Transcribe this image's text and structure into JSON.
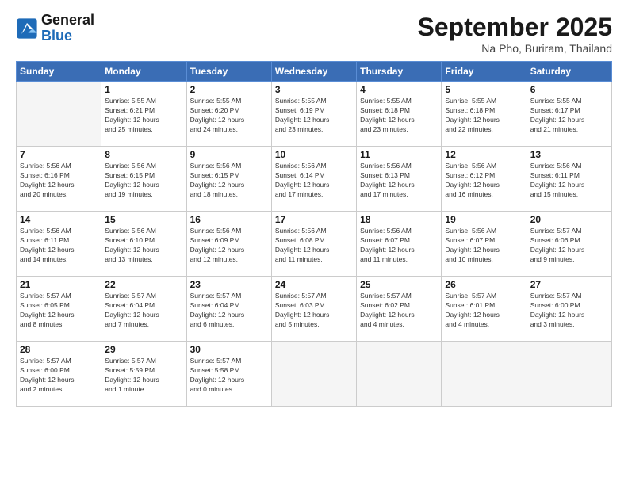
{
  "logo": {
    "line1": "General",
    "line2": "Blue"
  },
  "title": "September 2025",
  "location": "Na Pho, Buriram, Thailand",
  "weekdays": [
    "Sunday",
    "Monday",
    "Tuesday",
    "Wednesday",
    "Thursday",
    "Friday",
    "Saturday"
  ],
  "weeks": [
    [
      {
        "day": null,
        "info": null
      },
      {
        "day": "1",
        "info": "Sunrise: 5:55 AM\nSunset: 6:21 PM\nDaylight: 12 hours\nand 25 minutes."
      },
      {
        "day": "2",
        "info": "Sunrise: 5:55 AM\nSunset: 6:20 PM\nDaylight: 12 hours\nand 24 minutes."
      },
      {
        "day": "3",
        "info": "Sunrise: 5:55 AM\nSunset: 6:19 PM\nDaylight: 12 hours\nand 23 minutes."
      },
      {
        "day": "4",
        "info": "Sunrise: 5:55 AM\nSunset: 6:18 PM\nDaylight: 12 hours\nand 23 minutes."
      },
      {
        "day": "5",
        "info": "Sunrise: 5:55 AM\nSunset: 6:18 PM\nDaylight: 12 hours\nand 22 minutes."
      },
      {
        "day": "6",
        "info": "Sunrise: 5:55 AM\nSunset: 6:17 PM\nDaylight: 12 hours\nand 21 minutes."
      }
    ],
    [
      {
        "day": "7",
        "info": "Sunrise: 5:56 AM\nSunset: 6:16 PM\nDaylight: 12 hours\nand 20 minutes."
      },
      {
        "day": "8",
        "info": "Sunrise: 5:56 AM\nSunset: 6:15 PM\nDaylight: 12 hours\nand 19 minutes."
      },
      {
        "day": "9",
        "info": "Sunrise: 5:56 AM\nSunset: 6:15 PM\nDaylight: 12 hours\nand 18 minutes."
      },
      {
        "day": "10",
        "info": "Sunrise: 5:56 AM\nSunset: 6:14 PM\nDaylight: 12 hours\nand 17 minutes."
      },
      {
        "day": "11",
        "info": "Sunrise: 5:56 AM\nSunset: 6:13 PM\nDaylight: 12 hours\nand 17 minutes."
      },
      {
        "day": "12",
        "info": "Sunrise: 5:56 AM\nSunset: 6:12 PM\nDaylight: 12 hours\nand 16 minutes."
      },
      {
        "day": "13",
        "info": "Sunrise: 5:56 AM\nSunset: 6:11 PM\nDaylight: 12 hours\nand 15 minutes."
      }
    ],
    [
      {
        "day": "14",
        "info": "Sunrise: 5:56 AM\nSunset: 6:11 PM\nDaylight: 12 hours\nand 14 minutes."
      },
      {
        "day": "15",
        "info": "Sunrise: 5:56 AM\nSunset: 6:10 PM\nDaylight: 12 hours\nand 13 minutes."
      },
      {
        "day": "16",
        "info": "Sunrise: 5:56 AM\nSunset: 6:09 PM\nDaylight: 12 hours\nand 12 minutes."
      },
      {
        "day": "17",
        "info": "Sunrise: 5:56 AM\nSunset: 6:08 PM\nDaylight: 12 hours\nand 11 minutes."
      },
      {
        "day": "18",
        "info": "Sunrise: 5:56 AM\nSunset: 6:07 PM\nDaylight: 12 hours\nand 11 minutes."
      },
      {
        "day": "19",
        "info": "Sunrise: 5:56 AM\nSunset: 6:07 PM\nDaylight: 12 hours\nand 10 minutes."
      },
      {
        "day": "20",
        "info": "Sunrise: 5:57 AM\nSunset: 6:06 PM\nDaylight: 12 hours\nand 9 minutes."
      }
    ],
    [
      {
        "day": "21",
        "info": "Sunrise: 5:57 AM\nSunset: 6:05 PM\nDaylight: 12 hours\nand 8 minutes."
      },
      {
        "day": "22",
        "info": "Sunrise: 5:57 AM\nSunset: 6:04 PM\nDaylight: 12 hours\nand 7 minutes."
      },
      {
        "day": "23",
        "info": "Sunrise: 5:57 AM\nSunset: 6:04 PM\nDaylight: 12 hours\nand 6 minutes."
      },
      {
        "day": "24",
        "info": "Sunrise: 5:57 AM\nSunset: 6:03 PM\nDaylight: 12 hours\nand 5 minutes."
      },
      {
        "day": "25",
        "info": "Sunrise: 5:57 AM\nSunset: 6:02 PM\nDaylight: 12 hours\nand 4 minutes."
      },
      {
        "day": "26",
        "info": "Sunrise: 5:57 AM\nSunset: 6:01 PM\nDaylight: 12 hours\nand 4 minutes."
      },
      {
        "day": "27",
        "info": "Sunrise: 5:57 AM\nSunset: 6:00 PM\nDaylight: 12 hours\nand 3 minutes."
      }
    ],
    [
      {
        "day": "28",
        "info": "Sunrise: 5:57 AM\nSunset: 6:00 PM\nDaylight: 12 hours\nand 2 minutes."
      },
      {
        "day": "29",
        "info": "Sunrise: 5:57 AM\nSunset: 5:59 PM\nDaylight: 12 hours\nand 1 minute."
      },
      {
        "day": "30",
        "info": "Sunrise: 5:57 AM\nSunset: 5:58 PM\nDaylight: 12 hours\nand 0 minutes."
      },
      {
        "day": null,
        "info": null
      },
      {
        "day": null,
        "info": null
      },
      {
        "day": null,
        "info": null
      },
      {
        "day": null,
        "info": null
      }
    ]
  ]
}
